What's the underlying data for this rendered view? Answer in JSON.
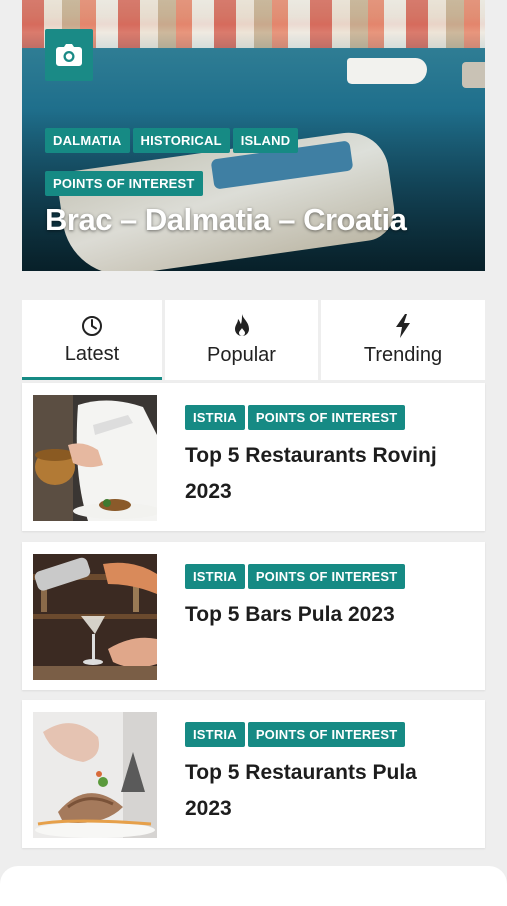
{
  "hero": {
    "tags": [
      "DALMATIA",
      "HISTORICAL",
      "ISLAND"
    ],
    "tags_row2": [
      "POINTS OF INTEREST"
    ],
    "title": "Brac – Dalmatia – Croatia",
    "camera_icon": "camera-icon"
  },
  "tabs": [
    {
      "label": "Latest",
      "icon": "clock-icon",
      "active": true
    },
    {
      "label": "Popular",
      "icon": "flame-icon",
      "active": false
    },
    {
      "label": "Trending",
      "icon": "bolt-icon",
      "active": false
    }
  ],
  "articles": [
    {
      "tags": [
        "ISTRIA",
        "POINTS OF INTEREST"
      ],
      "title_line1": "Top 5 Restaurants Rovinj",
      "title_line2": "2023"
    },
    {
      "tags": [
        "ISTRIA",
        "POINTS OF INTEREST"
      ],
      "title_line1": "Top 5 Bars Pula 2023",
      "title_line2": ""
    },
    {
      "tags": [
        "ISTRIA",
        "POINTS OF INTEREST"
      ],
      "title_line1": "Top 5 Restaurants Pula",
      "title_line2": "2023"
    }
  ],
  "colors": {
    "accent": "#168a84",
    "background": "#eeeeee",
    "card": "#ffffff"
  }
}
